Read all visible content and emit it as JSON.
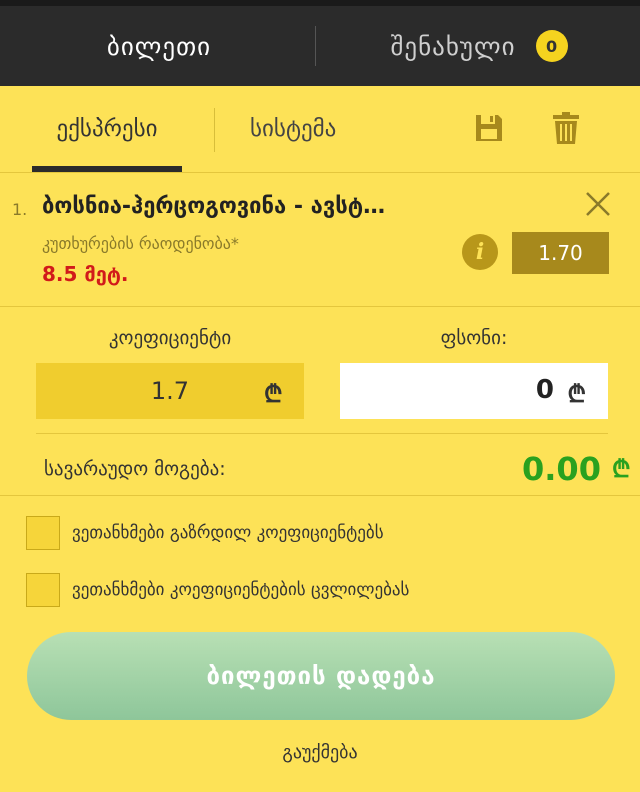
{
  "top_tabs": {
    "ticket_label": "ბილეთი",
    "saved_label": "შენახული",
    "saved_count": "0"
  },
  "sub_tabs": {
    "express_label": "ექსპრესი",
    "system_label": "სისტემა"
  },
  "icons": {
    "save": "floppy-disk-icon",
    "delete": "trash-icon",
    "close": "close-icon",
    "info": "info-icon"
  },
  "event": {
    "number": "1.",
    "title": "ბოსნია-ჰერცოგოვინა - ავსტ…",
    "market": "კუთხურების რაოდენობა*",
    "selection": "8.5 მეტ.",
    "odds": "1.70",
    "info_glyph": "i"
  },
  "coefficient": {
    "label": "კოეფიციენტი",
    "value": "1.7",
    "currency": "₾"
  },
  "stake": {
    "label": "ფსონი:",
    "value": "0",
    "currency": "₾"
  },
  "winnings": {
    "label": "სავარაუდო მოგება:",
    "value": "0.00",
    "currency": "₾"
  },
  "options": {
    "accept_increased": "ვეთანხმები გაზრდილ კოეფიციენტებს",
    "accept_changes": "ვეთანხმები კოეფიციენტების ცვლილებას"
  },
  "actions": {
    "place_bet": "ბილეთის დადება",
    "cancel": "გაუქმება"
  },
  "colors": {
    "background": "#fde257",
    "topbar": "#2b2b2b",
    "accent": "#f5d31f",
    "win_green": "#2aa11f",
    "selection_red": "#d11a1a"
  }
}
